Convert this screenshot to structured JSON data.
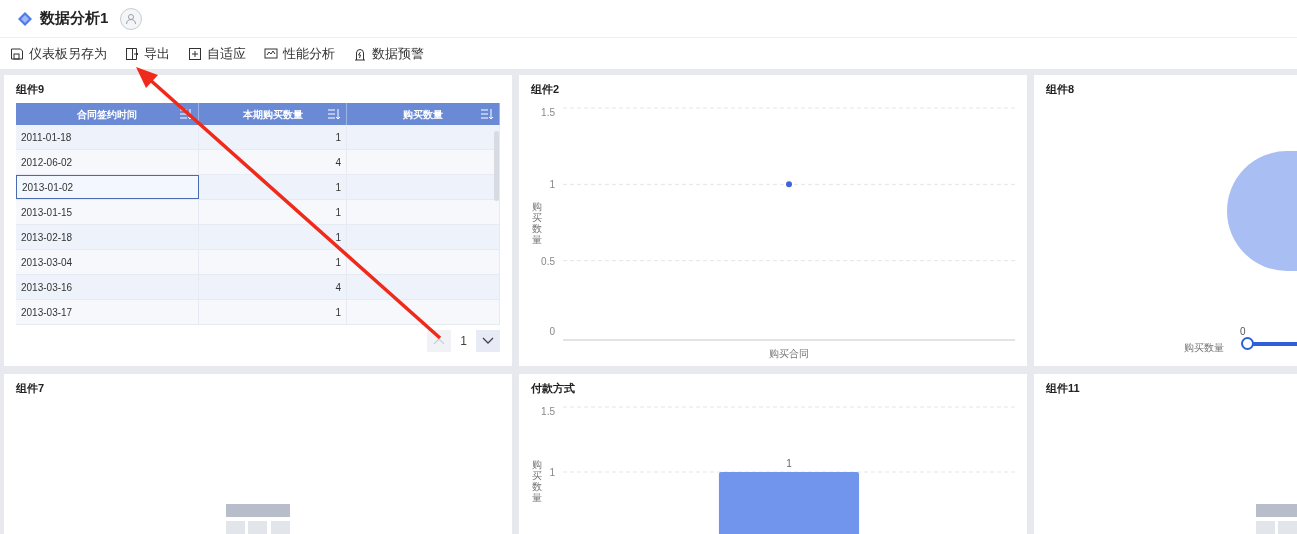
{
  "header": {
    "title": "数据分析1"
  },
  "toolbar": [
    {
      "kind": "save",
      "label": "仪表板另存为"
    },
    {
      "kind": "export",
      "label": "导出"
    },
    {
      "kind": "fit",
      "label": "自适应"
    },
    {
      "kind": "perf",
      "label": "性能分析"
    },
    {
      "kind": "alert",
      "label": "数据预警"
    }
  ],
  "widgets": [
    {
      "kind": "table",
      "title": "组件9",
      "columns": [
        "合同签约时间",
        "本期购买数量",
        "购买数量"
      ],
      "rows": [
        {
          "cells": [
            "2011-01-18",
            "1",
            ""
          ],
          "selected": false
        },
        {
          "cells": [
            "2012-06-02",
            "4",
            ""
          ],
          "selected": false
        },
        {
          "cells": [
            "2013-01-02",
            "1",
            ""
          ],
          "selected": true
        },
        {
          "cells": [
            "2013-01-15",
            "1",
            ""
          ],
          "selected": false
        },
        {
          "cells": [
            "2013-02-18",
            "1",
            ""
          ],
          "selected": false
        },
        {
          "cells": [
            "2013-03-04",
            "1",
            ""
          ],
          "selected": false
        },
        {
          "cells": [
            "2013-03-16",
            "4",
            ""
          ],
          "selected": false
        },
        {
          "cells": [
            "2013-03-17",
            "1",
            ""
          ],
          "selected": false
        }
      ],
      "pager": {
        "page": "1",
        "prev_disabled": true
      }
    },
    {
      "kind": "chart",
      "title": "组件2",
      "chart_data": {
        "type": "line",
        "xlabel": "购买合同",
        "ylabel": "购买数量",
        "values": [
          1
        ],
        "marker": "circle",
        "ylim": [
          0,
          1.5
        ],
        "yticks": [
          0,
          0.5,
          1,
          1.5
        ]
      }
    },
    {
      "kind": "pie",
      "title": "组件8",
      "legend": {
        "label": "购买数量",
        "min": "0"
      }
    },
    {
      "kind": "empty",
      "title": "组件7"
    },
    {
      "kind": "chart",
      "title": "付款方式",
      "chart_data": {
        "type": "bar",
        "ylabel": "购买数量",
        "values": [
          1
        ],
        "ylim": [
          0,
          1.5
        ],
        "yticks": [
          1,
          1.5
        ],
        "data_labels": true
      }
    },
    {
      "kind": "empty",
      "title": "组件11"
    }
  ]
}
